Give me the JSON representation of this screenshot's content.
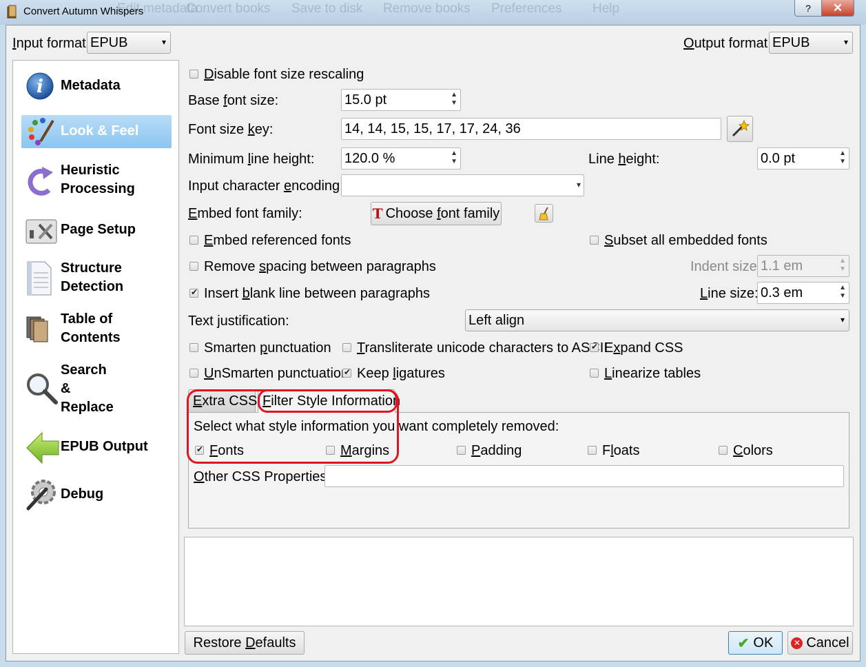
{
  "window": {
    "title": "Convert Autumn Whispers",
    "background_menu": [
      "Edit metadata",
      "Convert books",
      "Save to disk",
      "Remove books",
      "Preferences",
      "Help"
    ],
    "help_glyph": "?",
    "close_glyph": "✕"
  },
  "header": {
    "input_format_label": "Input format:",
    "input_format_value": "EPUB",
    "output_format_label": "Output format:",
    "output_format_value": "EPUB"
  },
  "sidebar": {
    "items": [
      {
        "label": "Metadata",
        "icon": "info-icon"
      },
      {
        "label": "Look & Feel",
        "icon": "palette-icon",
        "selected": true
      },
      {
        "label": "Heuristic\nProcessing",
        "icon": "heuristic-arrow-icon"
      },
      {
        "label": "Page Setup",
        "icon": "page-setup-icon"
      },
      {
        "label": "Structure\nDetection",
        "icon": "document-icon"
      },
      {
        "label": "Table of\nContents",
        "icon": "books-icon"
      },
      {
        "label": "Search\n&\nReplace",
        "icon": "magnifier-icon"
      },
      {
        "label": "EPUB Output",
        "icon": "green-arrow-icon"
      },
      {
        "label": "Debug",
        "icon": "debug-gear-icon"
      }
    ]
  },
  "look_feel": {
    "disable_rescaling": {
      "label": "Disable font size rescaling",
      "checked": false
    },
    "base_font_size": {
      "label": "Base font size:",
      "value": "15.0 pt"
    },
    "font_size_key": {
      "label": "Font size key:",
      "value": "14, 14, 15, 15, 17, 17, 24, 36"
    },
    "min_line_height": {
      "label": "Minimum line height:",
      "value": "120.0 %"
    },
    "line_height": {
      "label": "Line height:",
      "value": "0.0 pt"
    },
    "input_encoding": {
      "label": "Input character encoding:",
      "value": ""
    },
    "embed_font_family": {
      "label": "Embed font family:",
      "button": "Choose font family"
    },
    "embed_referenced": {
      "label": "Embed referenced fonts",
      "checked": false
    },
    "subset_embedded": {
      "label": "Subset all embedded fonts",
      "checked": false
    },
    "remove_spacing": {
      "label": "Remove spacing between paragraphs",
      "checked": false
    },
    "indent_size": {
      "label": "Indent size:",
      "value": "1.1 em"
    },
    "insert_blank": {
      "label": "Insert blank line between paragraphs",
      "checked": true
    },
    "line_size": {
      "label": "Line size:",
      "value": "0.3 em"
    },
    "text_justification": {
      "label": "Text justification:",
      "value": "Left align"
    },
    "smarten": {
      "label": "Smarten punctuation",
      "checked": false
    },
    "transliterate": {
      "label": "Transliterate unicode characters to ASCII",
      "checked": false
    },
    "expand_css": {
      "label": "Expand CSS",
      "checked": true
    },
    "unsmarten": {
      "label": "UnSmarten punctuation",
      "checked": false
    },
    "keep_ligatures": {
      "label": "Keep ligatures",
      "checked": true
    },
    "linearize": {
      "label": "Linearize tables",
      "checked": false
    }
  },
  "tabs": {
    "extra_css": "Extra CSS",
    "filter_style": "Filter Style Information"
  },
  "filter": {
    "prompt": "Select what style information you want completely removed:",
    "options": [
      {
        "label": "Fonts",
        "checked": true
      },
      {
        "label": "Margins",
        "checked": false
      },
      {
        "label": "Padding",
        "checked": false
      },
      {
        "label": "Floats",
        "checked": false
      },
      {
        "label": "Colors",
        "checked": false
      }
    ],
    "other_css_label": "Other CSS Properties:",
    "other_css_value": ""
  },
  "footer": {
    "restore_defaults": "Restore Defaults",
    "ok": "OK",
    "cancel": "Cancel"
  },
  "colors": {
    "highlight": "#e2141f",
    "selection": "#8cc6f0"
  }
}
